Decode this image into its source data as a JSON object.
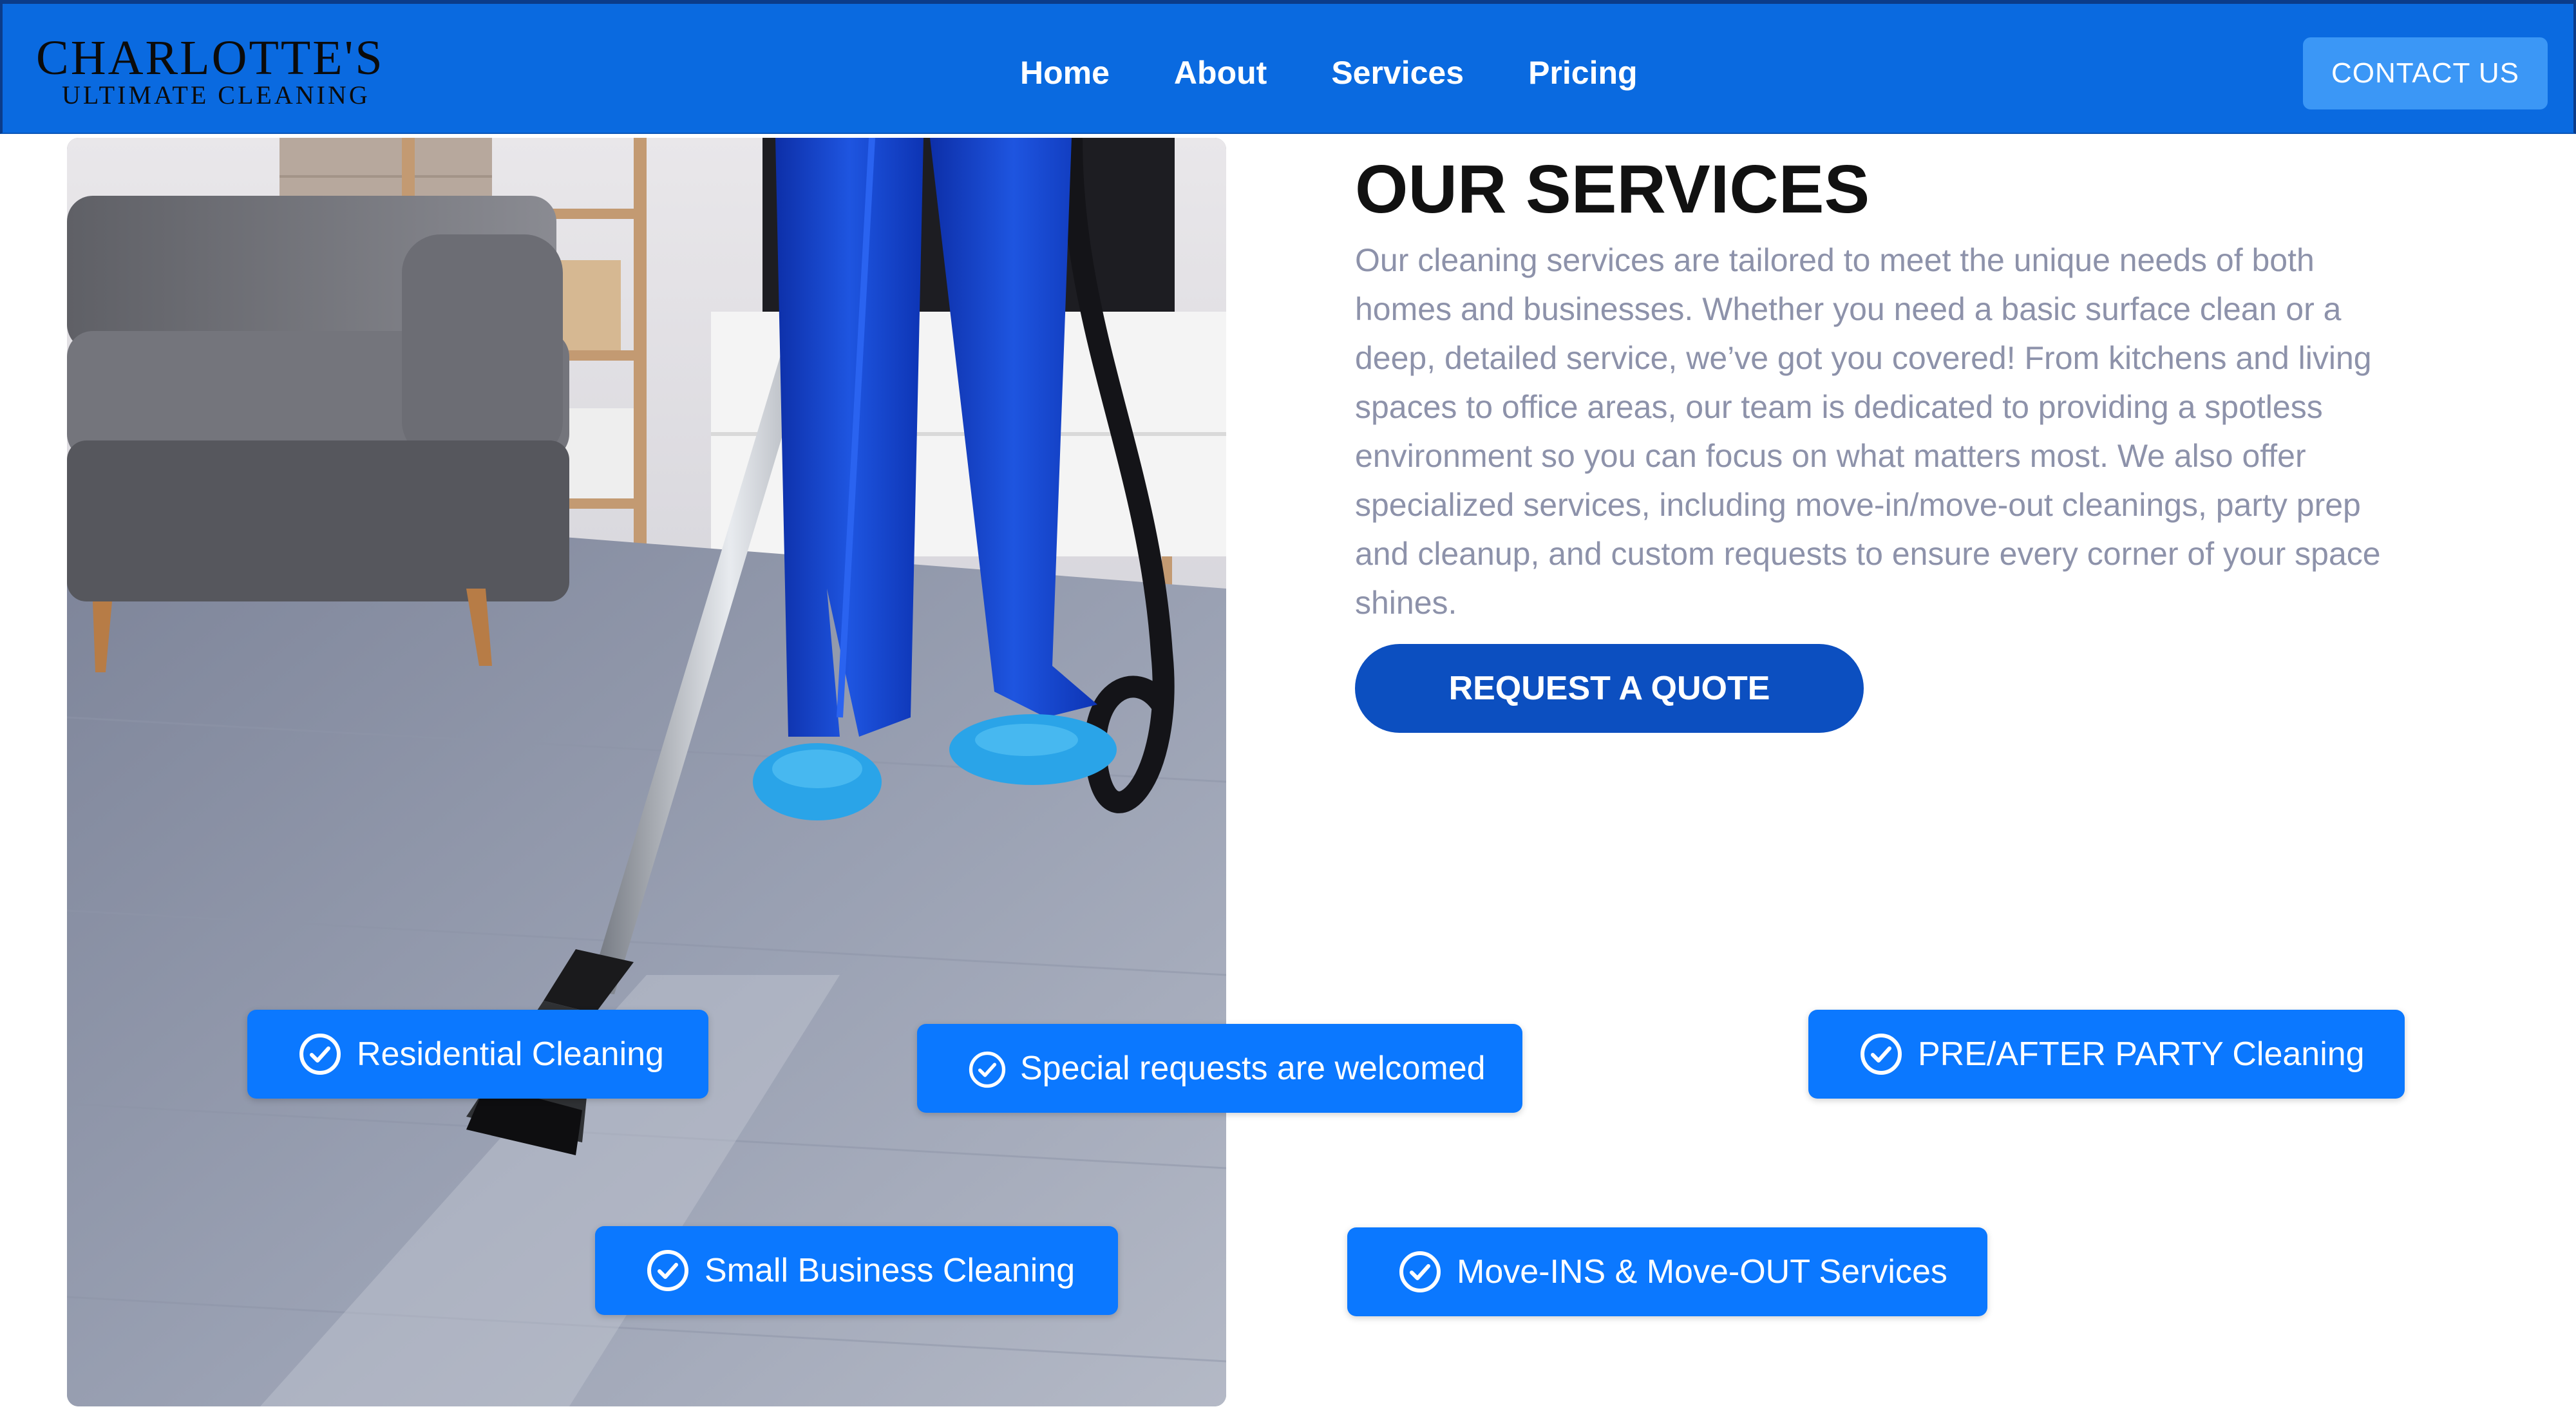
{
  "brand": {
    "name": "CHARLOTTE'S",
    "tagline": "ULTIMATE CLEANING"
  },
  "nav": {
    "links": [
      {
        "label": "Home"
      },
      {
        "label": "About"
      },
      {
        "label": "Services"
      },
      {
        "label": "Pricing"
      }
    ],
    "contact_label": "CONTACT US"
  },
  "services": {
    "title": "OUR SERVICES",
    "description": "Our cleaning services are tailored to meet the unique needs of both homes and businesses. Whether you need a basic surface clean or a deep, detailed service, we’ve got you covered! From kitchens and living spaces to office areas, our team is dedicated to providing a spotless environment so you can focus on what matters most. We also offer specialized services, including move-in/move-out cleanings, party prep and cleanup, and custom requests to ensure every corner of your space shines.",
    "quote_button": "REQUEST A QUOTE",
    "chips": [
      {
        "label": "Residential Cleaning",
        "icon": "check-circle-icon"
      },
      {
        "label": "Special requests are welcomed",
        "icon": "check-circle-icon"
      },
      {
        "label": "PRE/AFTER PARTY Cleaning",
        "icon": "check-circle-icon"
      },
      {
        "label": "Small Business Cleaning",
        "icon": "check-circle-icon"
      },
      {
        "label": "Move-INS & Move-OUT Services",
        "icon": "check-circle-icon"
      }
    ]
  },
  "colors": {
    "nav_bg": "#0a6ae0",
    "contact_button": "#3b97f6",
    "quote_button": "#0c4fc0",
    "chip_bg": "#0b78ff",
    "body_text": "#8d92aa"
  }
}
